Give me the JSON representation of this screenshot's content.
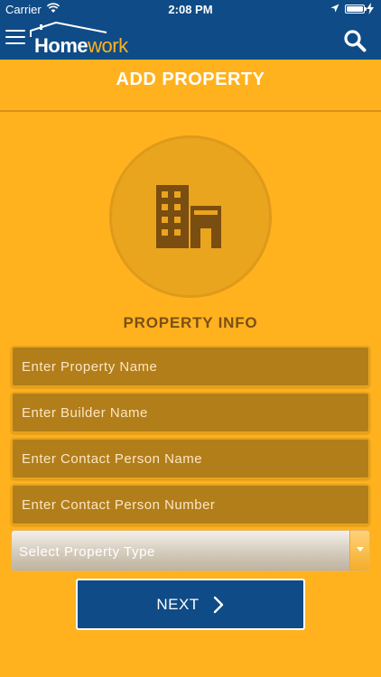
{
  "status_bar": {
    "carrier": "Carrier",
    "time": "2:08 PM"
  },
  "app": {
    "logo_home": "Home",
    "logo_work": "work"
  },
  "header": {
    "title": "ADD PROPERTY"
  },
  "section": {
    "title": "PROPERTY INFO"
  },
  "form": {
    "property_name": {
      "placeholder": "Enter Property Name",
      "value": ""
    },
    "builder_name": {
      "placeholder": "Enter Builder Name",
      "value": ""
    },
    "contact_person_name": {
      "placeholder": "Enter Contact Person Name",
      "value": ""
    },
    "contact_person_number": {
      "placeholder": "Enter Contact Person Number",
      "value": ""
    },
    "property_type": {
      "placeholder": "Select Property Type"
    }
  },
  "buttons": {
    "next_label": "NEXT"
  },
  "colors": {
    "primary": "#0f4b86",
    "background": "#ffb21e",
    "field": "#b27e1a",
    "icon": "#7a4d10"
  },
  "icons": [
    "menu-icon",
    "search-icon",
    "building-icon",
    "chevron-right-icon",
    "wifi-icon",
    "location-arrow-icon",
    "battery-icon",
    "charging-bolt-icon",
    "dropdown-caret-icon"
  ]
}
